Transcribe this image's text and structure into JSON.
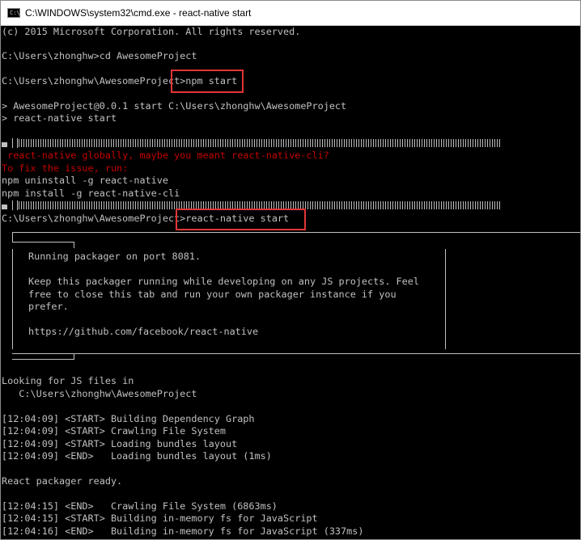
{
  "window": {
    "title": "C:\\WINDOWS\\system32\\cmd.exe - react-native  start",
    "icon": "cmd-icon",
    "icon_text": "C:\\"
  },
  "colors": {
    "console_bg": "#000000",
    "console_fg": "#c0c0c0",
    "error_text": "#c50000",
    "highlight_box": "#e23535"
  },
  "console": {
    "copyright": "(c) 2015 Microsoft Corporation. All rights reserved.",
    "cmd_cd": "C:\\Users\\zhonghw>cd AwesomeProject",
    "prompt_1": "C:\\Users\\zhonghw\\AwesomeProject>",
    "cmd_npm_start": "npm start",
    "npm_echo_1": "> AwesomeProject@0.0.1 start C:\\Users\\zhonghw\\AwesomeProject",
    "npm_echo_2": "> react-native start",
    "error_line_1": " react-native globally, maybe you meant react-native-cli?",
    "error_line_2": "To fix the issue, run:",
    "fix_cmd_1": "npm uninstall -g react-native",
    "fix_cmd_2": "npm install -g react-native-cli",
    "prompt_2": "C:\\Users\\zhonghw\\AwesomeProject>",
    "cmd_rn_start": "react-native start",
    "box_line_1": "Running packager on port 8081.",
    "box_line_2": "Keep this packager running while developing on any JS projects. Feel",
    "box_line_3": "free to close this tab and run your own packager instance if you",
    "box_line_4": "prefer.",
    "box_line_5": "https://github.com/facebook/react-native",
    "looking_1": "Looking for JS files in",
    "looking_2": "   C:\\Users\\zhonghw\\AwesomeProject",
    "log": [
      "[12:04:09] <START> Building Dependency Graph",
      "[12:04:09] <START> Crawling File System",
      "[12:04:09] <START> Loading bundles layout",
      "[12:04:09] <END>   Loading bundles layout (1ms)"
    ],
    "ready": "React packager ready.",
    "log2": [
      "[12:04:15] <END>   Crawling File System (6863ms)",
      "[12:04:15] <START> Building in-memory fs for JavaScript",
      "[12:04:16] <END>   Building in-memory fs for JavaScript (337ms)"
    ]
  }
}
